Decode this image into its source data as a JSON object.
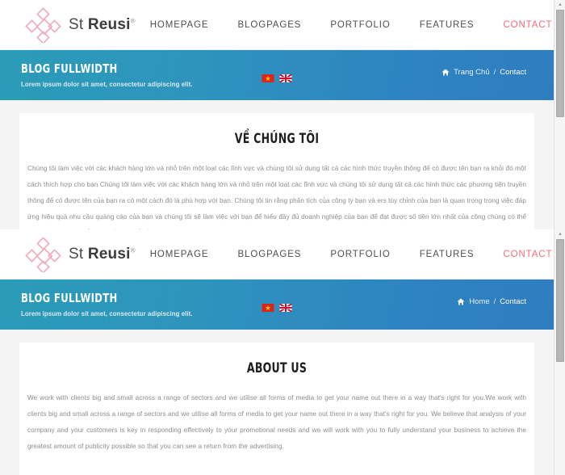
{
  "panes": [
    {
      "lang": "vi",
      "header": {
        "brand": {
          "thin": "St ",
          "bold": "Reusi",
          "registered": "®"
        },
        "nav": [
          {
            "label": "HOMEPAGE",
            "active": false
          },
          {
            "label": "BLOGPAGES",
            "active": false
          },
          {
            "label": "PORTFOLIO",
            "active": false
          },
          {
            "label": "FEATURES",
            "active": false
          },
          {
            "label": "CONTACT",
            "active": true
          }
        ]
      },
      "banner": {
        "title": "BLOG FULLWIDTH",
        "subtitle": "Lorem ipsum dolor sit amet, consectetur adipiscing elit.",
        "flags": [
          "vietnam-flag",
          "uk-flag"
        ],
        "breadcrumb": {
          "home_icon": "home-icon",
          "home": "Trang Chủ",
          "separator": "/",
          "current": "Contact"
        }
      },
      "section": {
        "title": "VỀ CHÚNG TÔI",
        "body": "Chúng tôi làm việc với các khách hàng lớn và nhỏ trên một loạt các lĩnh vực và chúng tôi sử dụng tất cả các hình thức truyền thông để có được tên bạn ra khỏi đó một cách thích hợp cho bạn Chúng tôi làm việc với các khách hàng lớn và nhỏ trên một loạt các lĩnh vực và chúng tôi sử dụng tất cả các hình thức các phương tiện truyền thông để có được tên của bạn ra có một cách đó là phù hợp với bạn. Chúng tôi tin rằng phân tích của công ty bạn và ers tùy chỉnh của bạn là quan trọng trong việc đáp ứng hiệu quả nhu cầu quảng cáo của bạn và chúng tôi sẽ làm việc với bạn để hiểu đầy đủ doanh nghiệp của bạn để đạt được số tiền lớn nhất của công chúng có thể vì vậy mà bạn có thể nhìn thấy một trở về từ quảng cáo."
      }
    },
    {
      "lang": "en",
      "header": {
        "brand": {
          "thin": "St ",
          "bold": "Reusi",
          "registered": "®"
        },
        "nav": [
          {
            "label": "HOMEPAGE",
            "active": false
          },
          {
            "label": "BLOGPAGES",
            "active": false
          },
          {
            "label": "PORTFOLIO",
            "active": false
          },
          {
            "label": "FEATURES",
            "active": false
          },
          {
            "label": "CONTACT",
            "active": true
          }
        ]
      },
      "banner": {
        "title": "BLOG FULLWIDTH",
        "subtitle": "Lorem ipsum dolor sit amet, consectetur adipiscing elit.",
        "flags": [
          "vietnam-flag",
          "uk-flag"
        ],
        "breadcrumb": {
          "home_icon": "home-icon",
          "home": "Home",
          "separator": "/",
          "current": "Contact"
        }
      },
      "section": {
        "title": "ABOUT US",
        "body": "We work with clients big and small across a range of sectors and we utilise all forms of media to get your name out there in a way that's right for you.We work with clients big and small across a range of sectors and we utilise all forms of media to get your name out there in a way that's right for you. We believe that analysis of your company and your customers is key in responding effectively to your promotional needs and we will work with you to fully understand your business to achieve the greatest amount of publicity possible so that you can see a return from the advertising."
      }
    }
  ],
  "colors": {
    "accent_pink": "#f26b7a",
    "banner_gradient_start": "#2a9cb8",
    "banner_gradient_end": "#2f7dc0",
    "page_background": "#f4f4f4",
    "body_text": "#8d8d8d"
  }
}
